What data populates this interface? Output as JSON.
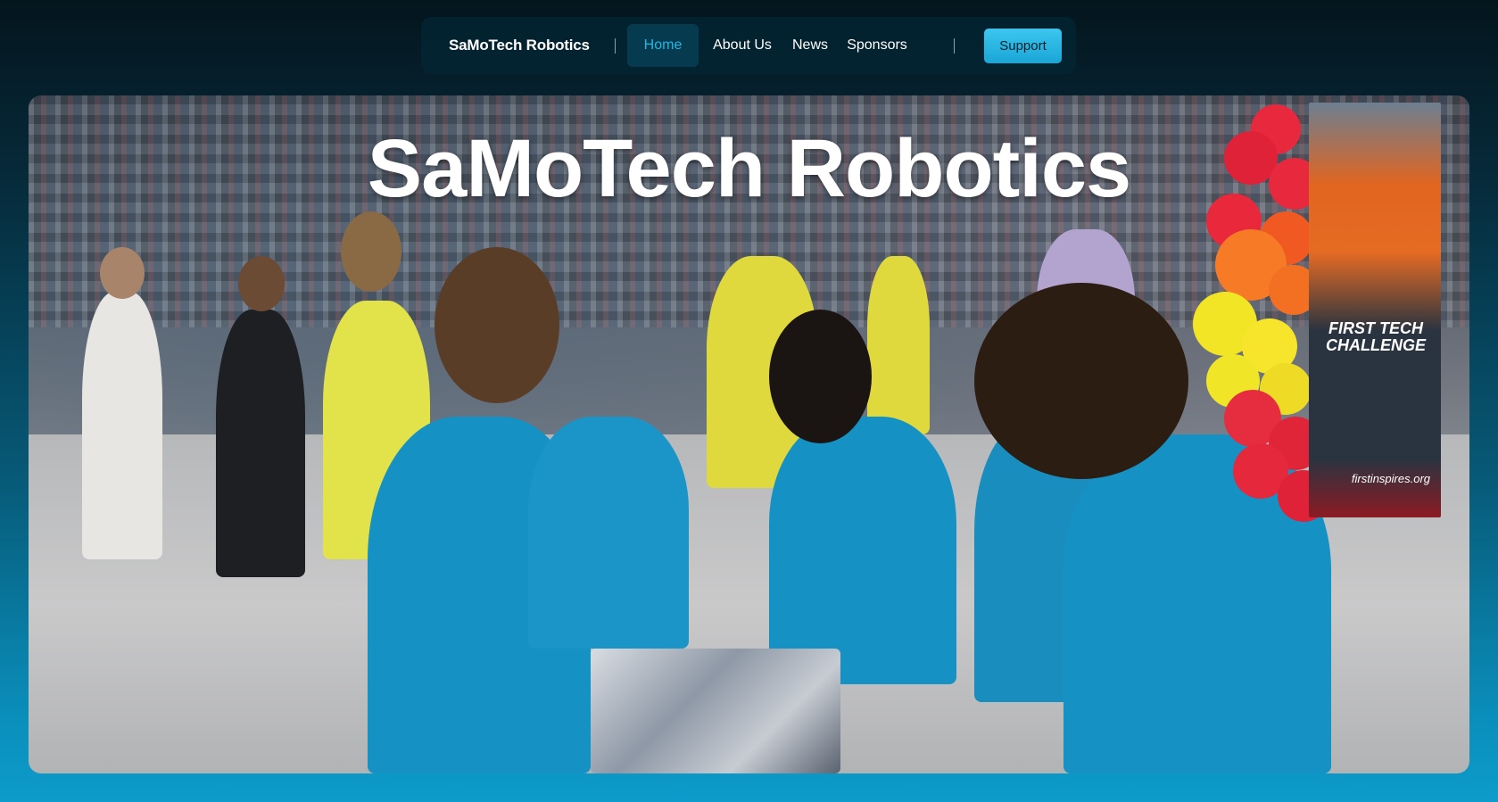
{
  "nav": {
    "brand": "SaMoTech Robotics",
    "links": [
      {
        "label": "Home",
        "active": true
      },
      {
        "label": "About Us",
        "active": false
      },
      {
        "label": "News",
        "active": false
      },
      {
        "label": "Sponsors",
        "active": false
      }
    ],
    "support_label": "Support"
  },
  "hero": {
    "title": "SaMoTech Robotics",
    "image_description": "",
    "banner_text": "FIRST TECH CHALLENGE",
    "banner_url": "firstinspires.org"
  },
  "colors": {
    "accent": "#22b6e6",
    "support_button": "#2bb6e3",
    "nav_bg": "#042432",
    "page_bg_top": "#04151d",
    "page_bg_bottom": "#0c9ccb",
    "team_shirt": "#1591c4"
  }
}
